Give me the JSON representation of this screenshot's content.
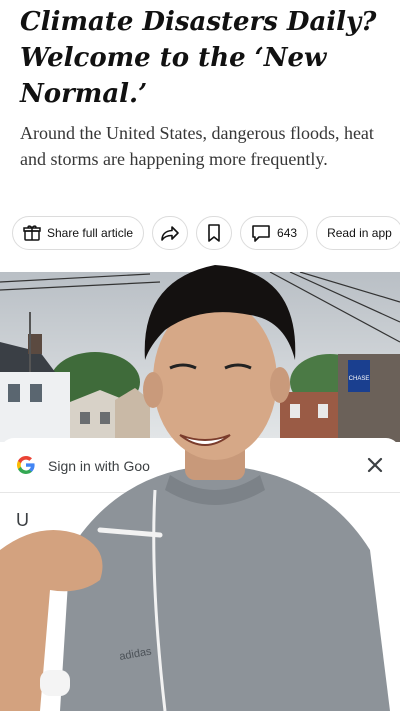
{
  "article": {
    "headline": "Climate Disasters Daily? Welcome to the ‘New Normal.’",
    "summary": "Around the United States, dangerous floods, heat and storms are happening more frequently.",
    "actions": {
      "share_label": "Share full article",
      "comment_count": "643",
      "read_in_app_label": "Read in app"
    }
  },
  "photo": {
    "sign_text": "CHASE"
  },
  "signin": {
    "title": "Sign in with Goo",
    "body_partial": "U"
  },
  "overlay": {
    "shirt_text": "adidas"
  },
  "icons": {
    "gift": "gift-icon",
    "share": "share-arrow-icon",
    "bookmark": "bookmark-icon",
    "comment": "comment-icon",
    "google": "google-g-icon",
    "close": "close-icon"
  },
  "colors": {
    "google_blue": "#4285F4",
    "google_red": "#EA4335",
    "google_yellow": "#FBBC05",
    "google_green": "#34A853"
  }
}
